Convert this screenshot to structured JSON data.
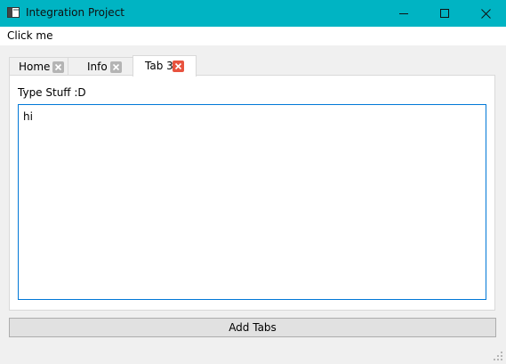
{
  "window": {
    "title": "Integration Project",
    "accent_color": "#00b4c3",
    "controls": [
      "minimize-icon",
      "maximize-icon",
      "close-icon"
    ]
  },
  "menu": {
    "items": [
      {
        "label": "Click me"
      }
    ]
  },
  "tabs": [
    {
      "label": "Home",
      "active": false,
      "close_icon": "close-icon"
    },
    {
      "label": "Info",
      "active": false,
      "close_icon": "close-icon"
    },
    {
      "label": "Tab 3",
      "active": true,
      "close_icon": "close-icon",
      "close_color": "#e81123"
    }
  ],
  "tab_content": {
    "label": "Type Stuff :D",
    "text_value": "hi",
    "focus_border_color": "#0078d7"
  },
  "add_button": {
    "label": "Add Tabs"
  }
}
